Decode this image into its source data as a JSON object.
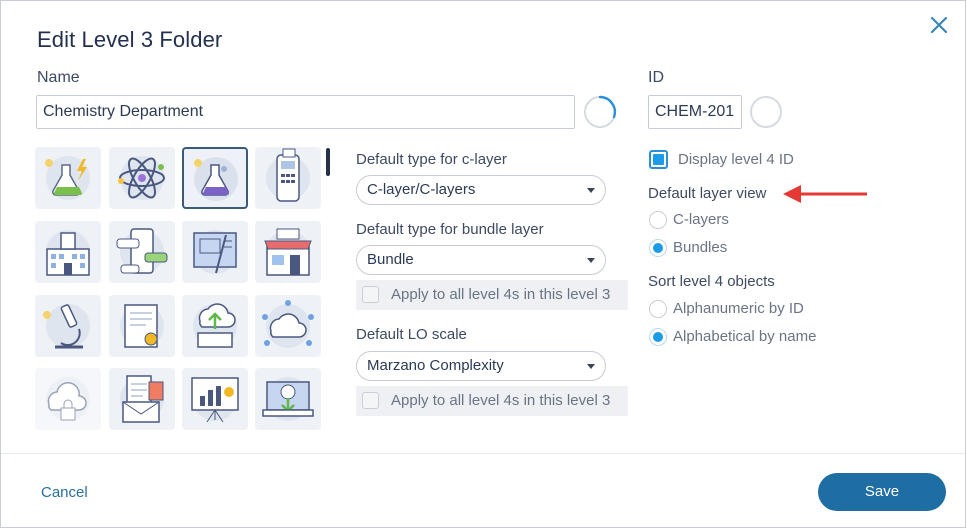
{
  "dialog": {
    "title": "Edit Level 3 Folder",
    "close_icon": "close-icon"
  },
  "name": {
    "label": "Name",
    "value": "Chemistry Department"
  },
  "id": {
    "label": "ID",
    "value": "CHEM-201"
  },
  "icons": [
    {
      "name": "flask-lightning-icon",
      "selected": false,
      "faded": false
    },
    {
      "name": "atom-icon",
      "selected": false,
      "faded": false
    },
    {
      "name": "flask-icon",
      "selected": true,
      "faded": false
    },
    {
      "name": "payment-terminal-icon",
      "selected": false,
      "faded": false
    },
    {
      "name": "city-building-icon",
      "selected": false,
      "faded": false
    },
    {
      "name": "mobile-chat-icon",
      "selected": false,
      "faded": false
    },
    {
      "name": "blueprint-icon",
      "selected": false,
      "faded": false
    },
    {
      "name": "storefront-icon",
      "selected": false,
      "faded": false
    },
    {
      "name": "microscope-icon",
      "selected": false,
      "faded": false
    },
    {
      "name": "certificate-icon",
      "selected": false,
      "faded": false
    },
    {
      "name": "cloud-upload-laptop-icon",
      "selected": false,
      "faded": false
    },
    {
      "name": "cloud-network-icon",
      "selected": false,
      "faded": false
    },
    {
      "name": "cloud-lock-icon",
      "selected": false,
      "faded": true
    },
    {
      "name": "email-documents-icon",
      "selected": false,
      "faded": false
    },
    {
      "name": "presentation-chart-icon",
      "selected": false,
      "faded": false
    },
    {
      "name": "laptop-download-icon",
      "selected": false,
      "faded": false
    }
  ],
  "clayer": {
    "label": "Default type for c-layer",
    "selected": "C-layer/C-layers"
  },
  "bundle": {
    "label": "Default type for bundle layer",
    "selected": "Bundle",
    "apply_label": "Apply to all level 4s in this level 3"
  },
  "lo_scale": {
    "label": "Default LO scale",
    "selected": "Marzano Complexity",
    "apply_label": "Apply to all level 4s in this level 3"
  },
  "display_id": {
    "label": "Display level 4 ID",
    "checked": true
  },
  "layer_view": {
    "title": "Default layer view",
    "options": [
      "C-layers",
      "Bundles"
    ],
    "selected": "Bundles"
  },
  "sort": {
    "title": "Sort level 4 objects",
    "options": [
      "Alphanumeric by ID",
      "Alphabetical by name"
    ],
    "selected": "Alphabetical by name"
  },
  "footer": {
    "cancel_label": "Cancel",
    "save_label": "Save"
  },
  "colors": {
    "accent": "#1d9be6",
    "primary_button": "#1e6da3",
    "annotation_arrow": "#e53935",
    "title": "#23304f"
  }
}
